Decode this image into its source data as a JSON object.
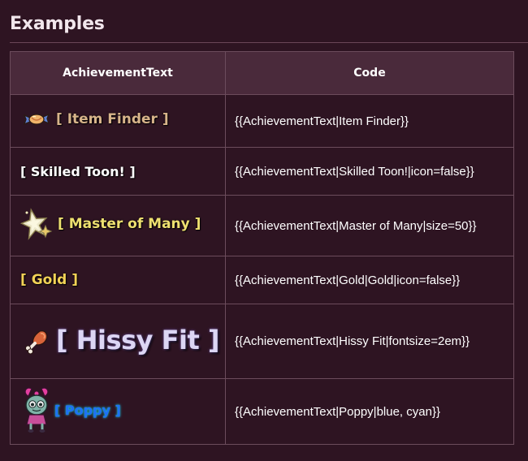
{
  "page": {
    "heading": "Examples"
  },
  "table": {
    "headers": {
      "achievement": "AchievementText",
      "code": "Code"
    },
    "rows": [
      {
        "achievement": "[ Item Finder ]",
        "code": "{{AchievementText|Item Finder}}",
        "icon": "candy-icon",
        "color": "#d7b48a"
      },
      {
        "achievement": "[ Skilled Toon! ]",
        "code": "{{AchievementText|Skilled Toon!|icon=false}}",
        "icon": null,
        "color": "#ffffff"
      },
      {
        "achievement": "[ Master of Many ]",
        "code": "{{AchievementText|Master of Many|size=50}}",
        "icon": "sparkle-star-icon",
        "color": "#eee070"
      },
      {
        "achievement": "[ Gold ]",
        "code": "{{AchievementText|Gold|Gold|icon=false}}",
        "icon": null,
        "color": "#f2d256"
      },
      {
        "achievement": "[ Hissy Fit ]",
        "code": "{{AchievementText|Hissy Fit|fontsize=2em}}",
        "icon": "drumstick-icon",
        "color": "#dcd6f4"
      },
      {
        "achievement": "[ Poppy ]",
        "code": "{{AchievementText|Poppy|blue, cyan}}",
        "icon": "poppy-doll-icon",
        "color": "#1f6ff5"
      }
    ]
  }
}
